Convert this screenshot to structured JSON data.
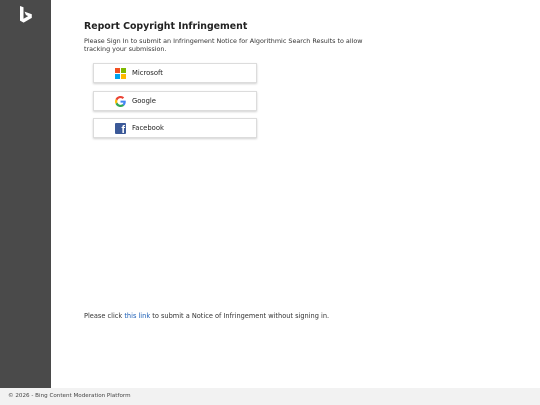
{
  "page": {
    "title": "Report Copyright Infringement",
    "subtitle": "Please Sign In to submit an Infringement Notice for Algorithmic Search Results to allow tracking your submission."
  },
  "signin": {
    "microsoft": {
      "label": "Microsoft",
      "icon": "microsoft-logo-icon"
    },
    "google": {
      "label": "Google",
      "icon": "google-logo-icon"
    },
    "facebook": {
      "label": "Facebook",
      "icon": "facebook-logo-icon"
    }
  },
  "notice": {
    "prefix": "Please click",
    "link_text": "this link",
    "suffix": "to submit a Notice of Infringement without signing in."
  },
  "footer": {
    "text": "© 2026 - Bing Content Moderation Platform"
  },
  "colors": {
    "sidebar": "#4a4a4a",
    "link": "#1a5db5",
    "facebook": "#3b5998",
    "ms_red": "#f25022",
    "ms_green": "#7fba00",
    "ms_blue": "#00a4ef",
    "ms_yellow": "#ffb900"
  }
}
